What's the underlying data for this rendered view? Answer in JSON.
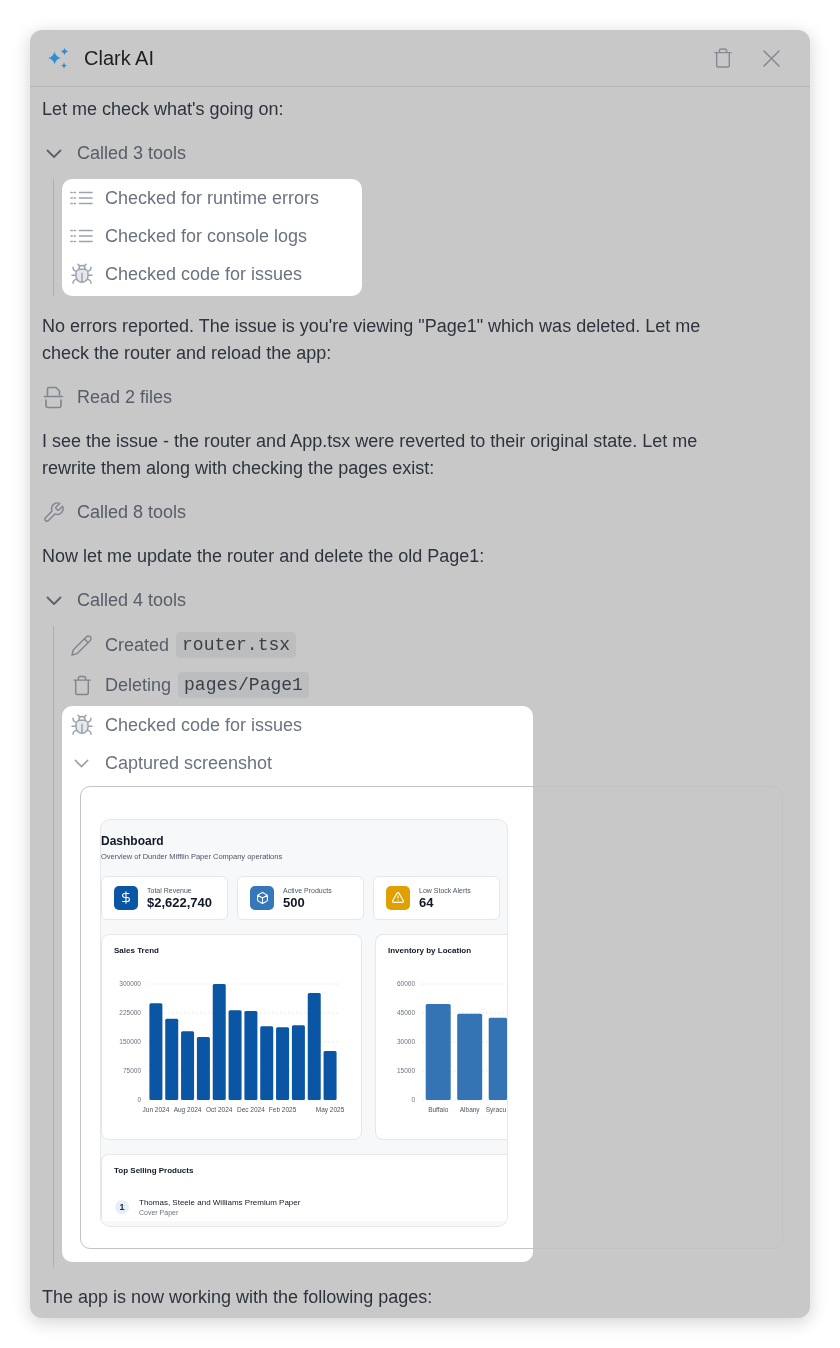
{
  "header": {
    "title": "Clark AI"
  },
  "messages": [
    {
      "kind": "text",
      "text": "Let me check what's going on:"
    },
    {
      "kind": "tools",
      "label": "Called 3 tools",
      "expanded": true,
      "items": [
        {
          "kind": "errors",
          "label": "Checked for runtime errors",
          "highlighted": true
        },
        {
          "kind": "logs",
          "label": "Checked for console logs",
          "highlighted": true
        },
        {
          "kind": "lint",
          "label": "Checked code for issues",
          "highlighted": true
        }
      ]
    },
    {
      "kind": "text",
      "text": "No errors reported. The issue is you're viewing \"Page1\" which was deleted. Let me check the router and reload the app:"
    },
    {
      "kind": "read",
      "label": "Read 2 files"
    },
    {
      "kind": "text",
      "text": "I see the issue - the router and App.tsx were reverted to their original state. Let me rewrite them along with checking the pages exist:"
    },
    {
      "kind": "tools",
      "label": "Called 8 tools",
      "expanded": false
    },
    {
      "kind": "text",
      "text": "Now let me update the router and delete the old Page1:"
    },
    {
      "kind": "tools",
      "label": "Called 4 tools",
      "expanded": true,
      "items": [
        {
          "kind": "create",
          "label": "Created",
          "code": "router.tsx",
          "highlighted": false
        },
        {
          "kind": "delete",
          "label": "Deleting",
          "code": "pages/Page1",
          "highlighted": false
        },
        {
          "kind": "lint",
          "label": "Checked code for issues",
          "highlighted": true
        },
        {
          "kind": "screenshot",
          "label": "Captured screenshot",
          "expanded": true,
          "highlighted": true,
          "screenshot": {
            "title": "Dashboard",
            "subtitle": "Overview of Dunder Mifflin Paper Company operations",
            "stats": [
              {
                "kind": "revenue",
                "label": "Total Revenue",
                "value": "$2,622,740",
                "color": "#0b55a5"
              },
              {
                "kind": "products",
                "label": "Active Products",
                "value": "500",
                "color": "#3577b8"
              },
              {
                "kind": "alerts",
                "label": "Low Stock Alerts",
                "value": "64",
                "color": "#e0a100"
              }
            ],
            "charts": [
              {
                "chart_data": {
                  "type": "bar",
                  "title": "Sales Trend",
                  "categories": [
                    "Jun 2024",
                    null,
                    "Aug 2024",
                    null,
                    "Oct 2024",
                    null,
                    "Dec 2024",
                    null,
                    "Feb 2025",
                    null,
                    null,
                    "May 2025"
                  ],
                  "values": [
                    250000,
                    210000,
                    178000,
                    163000,
                    300000,
                    232000,
                    230000,
                    191000,
                    188000,
                    193000,
                    277000,
                    127000
                  ],
                  "ylim": [
                    0,
                    300000
                  ],
                  "yticks": [
                    0,
                    75000,
                    150000,
                    225000,
                    300000
                  ],
                  "grid": true
                }
              },
              {
                "chart_data": {
                  "type": "bar",
                  "title": "Inventory by Location",
                  "categories": [
                    "Buffalo",
                    "Albany",
                    "Syracu"
                  ],
                  "values": [
                    49700,
                    44600,
                    42500
                  ],
                  "ylim": [
                    0,
                    60000
                  ],
                  "yticks": [
                    0,
                    15000,
                    30000,
                    45000,
                    60000
                  ],
                  "grid": true
                }
              }
            ],
            "top_products": {
              "title": "Top Selling Products",
              "rows": [
                {
                  "rank": "1",
                  "name": "Thomas, Steele and Williams Premium Paper",
                  "category": "Cover Paper"
                }
              ]
            }
          }
        }
      ]
    },
    {
      "kind": "text",
      "text": "The app is now working with the following pages:"
    }
  ]
}
